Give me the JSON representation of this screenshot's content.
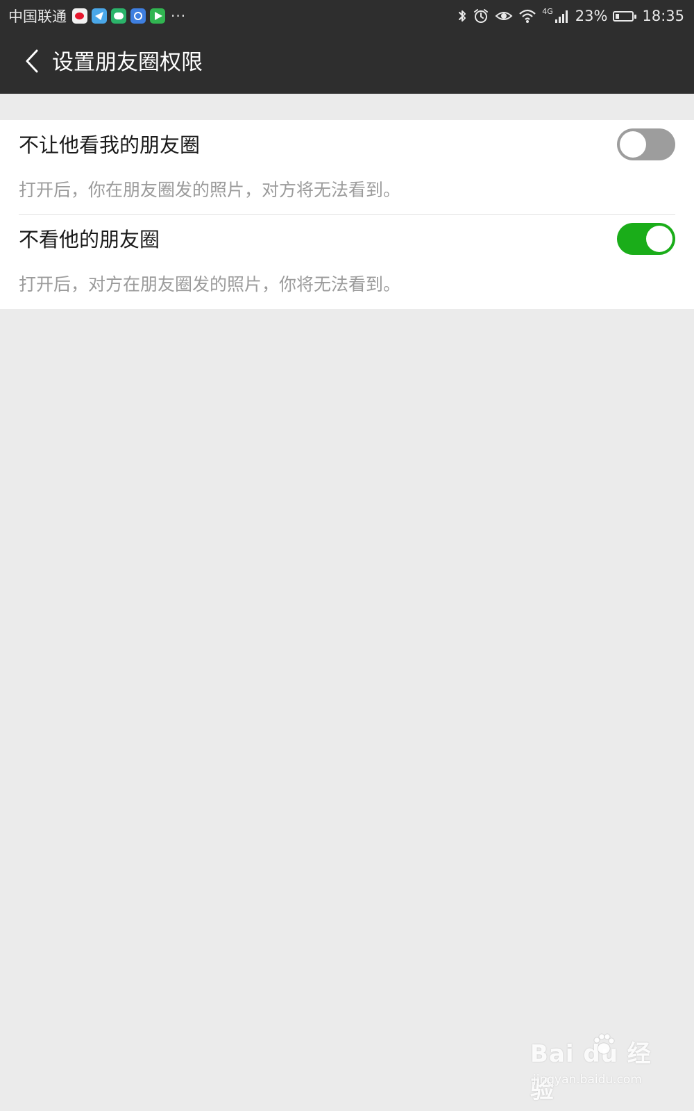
{
  "status_bar": {
    "carrier": "中国联通",
    "more": "···",
    "network": "4G",
    "battery_text": "23%",
    "battery_level": 0.23,
    "clock": "18:35",
    "app_icons": [
      "weibo-icon",
      "mail-icon",
      "chat-icon",
      "video-icon",
      "player-icon"
    ],
    "status_icons": [
      "bluetooth-icon",
      "alarm-icon",
      "eye-icon",
      "wifi-icon",
      "signal-icon",
      "battery-icon"
    ]
  },
  "header": {
    "title": "设置朋友圈权限",
    "back_icon": "back-arrow-icon"
  },
  "settings": [
    {
      "label": "不让他看我的朋友圈",
      "description": "打开后，你在朋友圈发的照片，对方将无法看到。",
      "enabled": false
    },
    {
      "label": "不看他的朋友圈",
      "description": "打开后，对方在朋友圈发的照片，你将无法看到。",
      "enabled": true
    }
  ],
  "watermark": {
    "main": "Bai du 经验",
    "sub": "jingyan.baidu.com"
  },
  "colors": {
    "header_bg": "#2e2e2e",
    "page_bg": "#ebebeb",
    "toggle_on": "#1aad19",
    "toggle_off": "#9d9d9d",
    "desc_text": "#9b9b9b"
  }
}
